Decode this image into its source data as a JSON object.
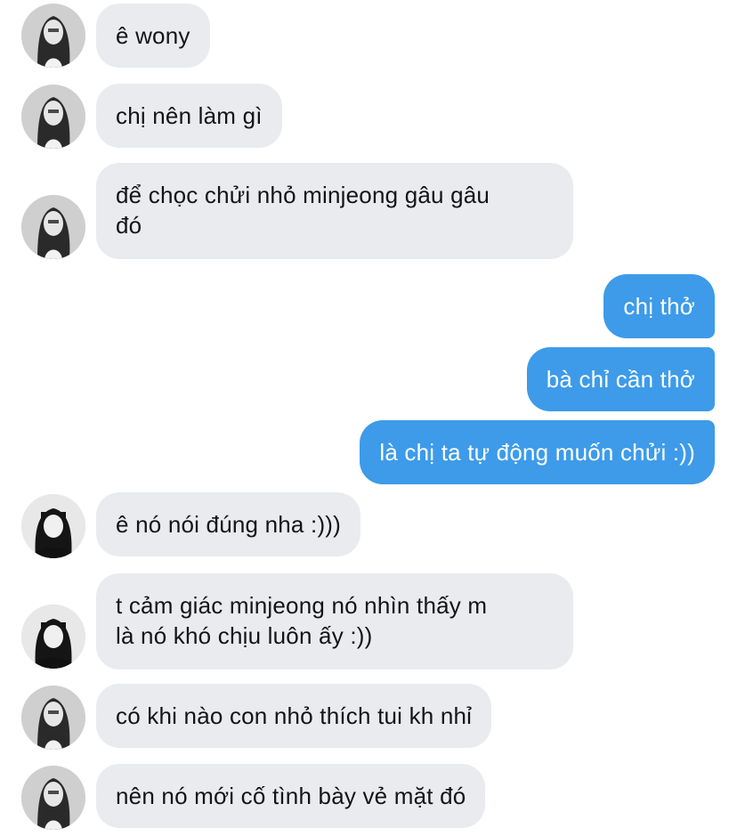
{
  "messages": [
    {
      "side": "in",
      "avatar": "girl-a",
      "text": "ê wony"
    },
    {
      "side": "in",
      "avatar": "girl-a",
      "text": "chị nên làm gì"
    },
    {
      "side": "in",
      "avatar": "girl-a",
      "line1": "để chọc chửi nhỏ minjeong gâu gâu",
      "line2": "đó"
    },
    {
      "side": "out",
      "text": "chị thở"
    },
    {
      "side": "out",
      "text": "bà chỉ cần thở"
    },
    {
      "side": "out",
      "text": "là chị ta tự động muốn chửi :))"
    },
    {
      "side": "in",
      "avatar": "girl-b",
      "text": "ê nó nói đúng nha :)))"
    },
    {
      "side": "in",
      "avatar": "girl-b",
      "line1": "t cảm giác minjeong nó nhìn thấy m",
      "line2": "là nó khó chịu luôn ấy :))"
    },
    {
      "side": "in",
      "avatar": "girl-a",
      "text": "có khi nào con nhỏ thích tui kh nhỉ"
    },
    {
      "side": "in",
      "avatar": "girl-a",
      "text": "nên nó mới cố tình bày vẻ mặt đó"
    }
  ],
  "colors": {
    "incoming_bubble": "#e9ebef",
    "outgoing_bubble": "#3d9be9",
    "incoming_text": "#141414",
    "outgoing_text": "#ffffff"
  }
}
